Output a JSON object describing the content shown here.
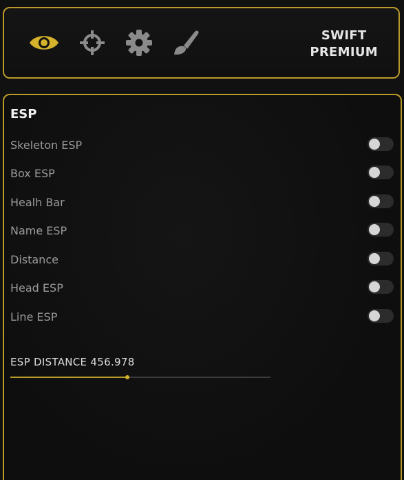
{
  "header": {
    "icons": [
      {
        "name": "eye-icon",
        "active": true
      },
      {
        "name": "crosshair-icon",
        "active": false
      },
      {
        "name": "gear-icon",
        "active": false
      },
      {
        "name": "brush-icon",
        "active": false
      }
    ],
    "brand_line1": "SWIFT",
    "brand_line2": "PREMIUM"
  },
  "esp": {
    "title": "ESP",
    "options": [
      {
        "label": "Skeleton ESP",
        "enabled": false
      },
      {
        "label": "Box ESP",
        "enabled": false
      },
      {
        "label": "Healh Bar",
        "enabled": false
      },
      {
        "label": "Name ESP",
        "enabled": false
      },
      {
        "label": "Distance",
        "enabled": false
      },
      {
        "label": "Head ESP",
        "enabled": false
      },
      {
        "label": "Line ESP",
        "enabled": false
      }
    ],
    "distance_label": "ESP DISTANCE 456.978",
    "distance_fraction": 0.45
  },
  "colors": {
    "accent": "#d4b22c",
    "border": "#b89a2a",
    "background": "#111111",
    "inactive_icon": "#8a8a8a",
    "label": "#9a9a9a"
  }
}
